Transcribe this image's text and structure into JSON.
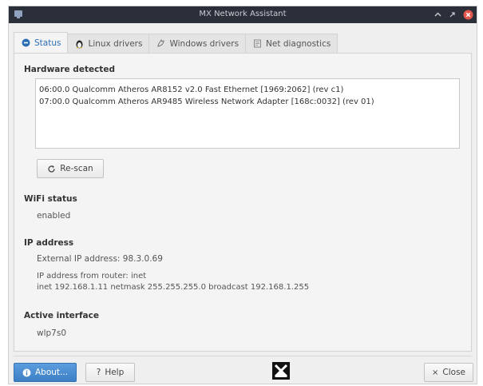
{
  "window": {
    "title": "MX Network Assistant"
  },
  "tabs": [
    {
      "label": "Status",
      "active": true
    },
    {
      "label": "Linux drivers",
      "active": false
    },
    {
      "label": "Windows drivers",
      "active": false
    },
    {
      "label": "Net diagnostics",
      "active": false
    }
  ],
  "hardware": {
    "heading": "Hardware detected",
    "items": [
      "06:00.0  Qualcomm Atheros AR8152 v2.0 Fast Ethernet [1969:2062] (rev c1)",
      "07:00.0  Qualcomm Atheros AR9485 Wireless Network Adapter [168c:0032] (rev 01)"
    ],
    "rescan_label": "Re-scan"
  },
  "wifi": {
    "heading": "WiFi status",
    "value": "enabled"
  },
  "ip": {
    "heading": "IP address",
    "external": "External IP address: 98.3.0.69",
    "router_label": "IP address from router: inet",
    "router_value": "inet 192.168.1.11  netmask 255.255.255.0  broadcast 192.168.1.255"
  },
  "interface": {
    "heading": "Active interface",
    "value": "wlp7s0"
  },
  "footer": {
    "about_label": "About...",
    "help_label": "Help",
    "close_label": "Close"
  },
  "colors": {
    "titlebar": "#2b2f3a",
    "accent": "#3c7fc5",
    "close_button": "#e2574c"
  }
}
